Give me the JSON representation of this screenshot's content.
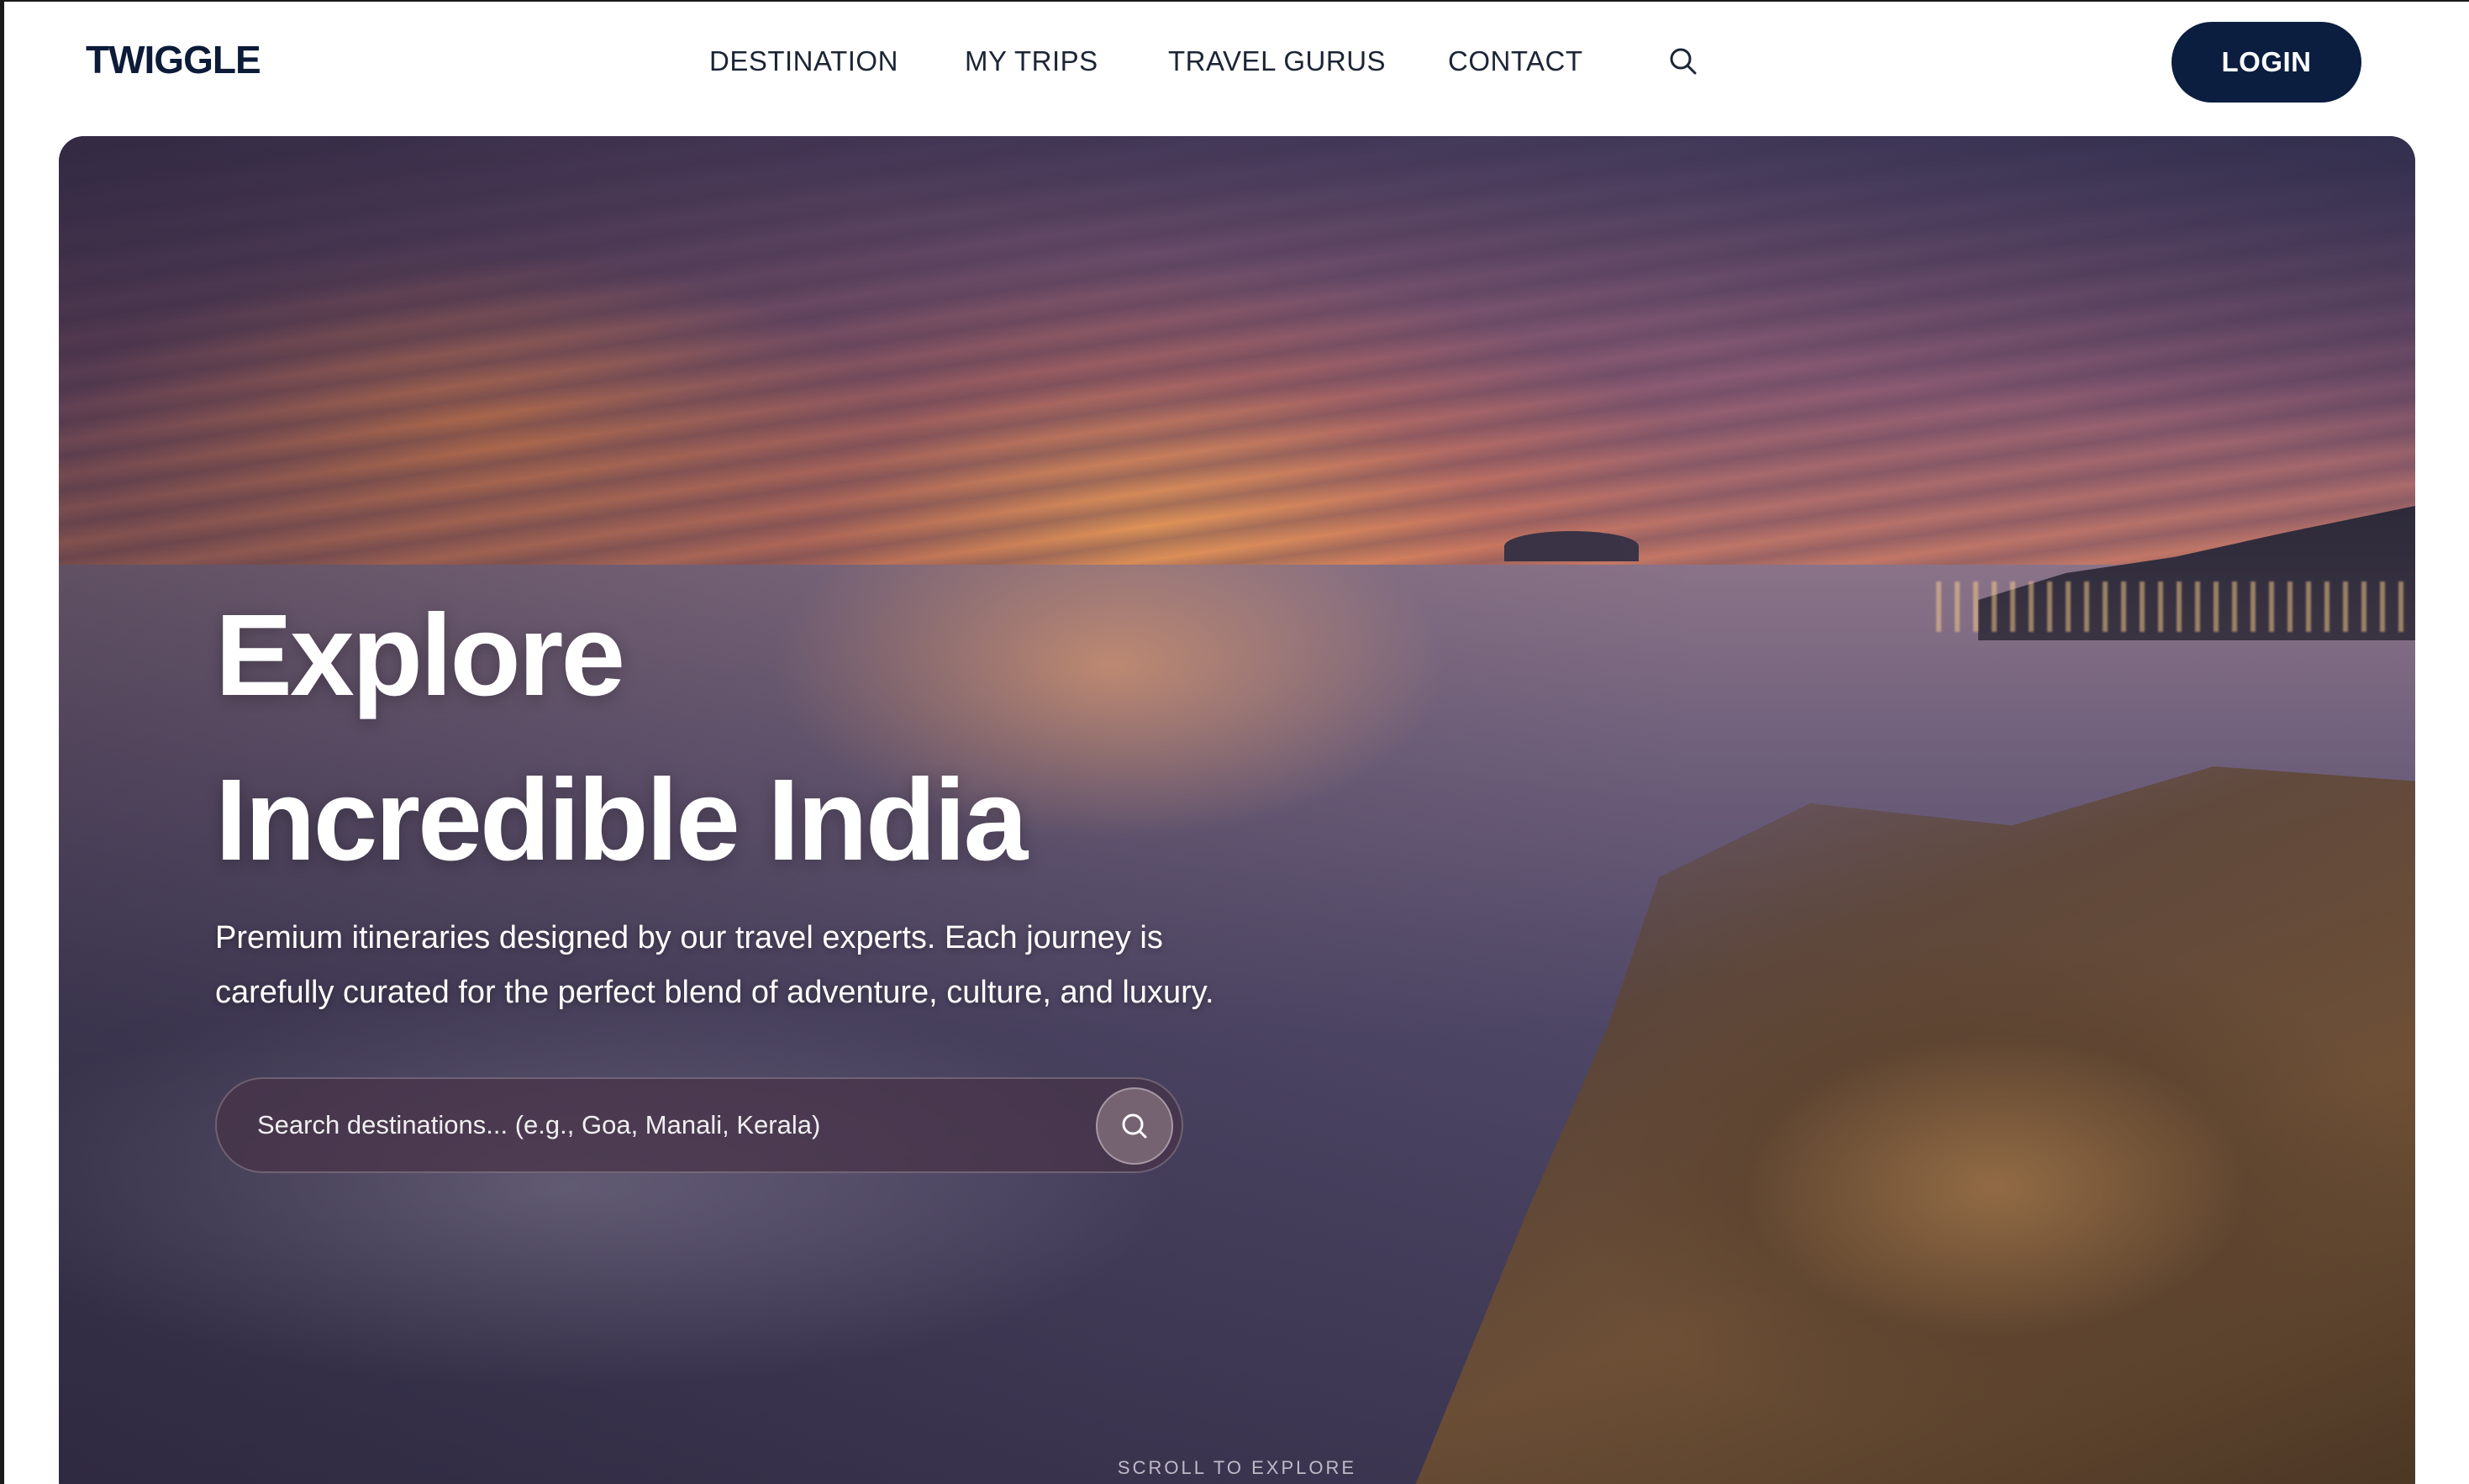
{
  "brand": {
    "logo_text": "TWIGGLE"
  },
  "nav": {
    "items": [
      {
        "label": "DESTINATION"
      },
      {
        "label": "MY TRIPS"
      },
      {
        "label": "TRAVEL GURUS"
      },
      {
        "label": "CONTACT"
      }
    ],
    "search_icon": "search-icon",
    "login_label": "LOGIN"
  },
  "hero": {
    "title_line1": "Explore",
    "title_line2": "Incredible India",
    "description": "Premium itineraries designed by our travel experts. Each journey is carefully curated for the perfect blend of adventure, culture, and luxury.",
    "search": {
      "placeholder": "Search destinations... (e.g., Goa, Manali, Kerala)",
      "value": "",
      "button_icon": "search-icon"
    },
    "scroll_hint": "SCROLL TO EXPLORE",
    "background_image": "sunset-over-rocky-coastline"
  },
  "colors": {
    "brand_navy": "#0b1e3f",
    "nav_text": "#1c2536",
    "hero_text": "#ffffff"
  }
}
